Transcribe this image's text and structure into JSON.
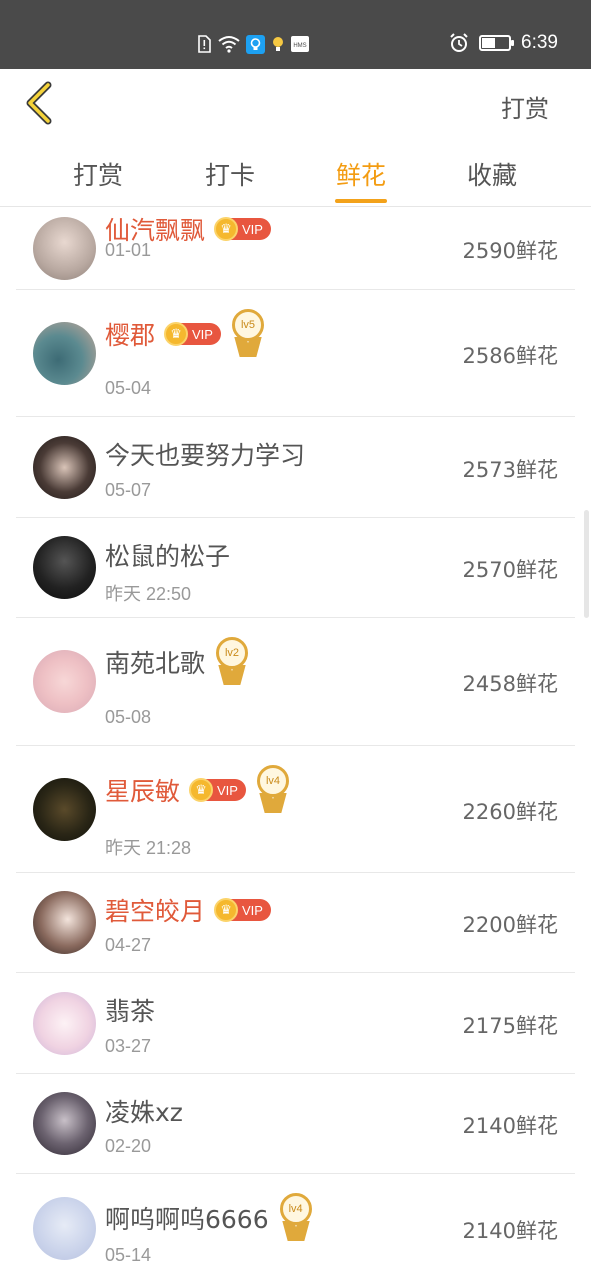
{
  "status_bar": {
    "time": "6:39",
    "icons": [
      "sim-alert-icon",
      "wifi-icon",
      "app-notification-icon",
      "bulb-icon",
      "hms-icon"
    ],
    "right_icons": [
      "alarm-icon",
      "battery-icon"
    ],
    "battery_level": 0.5
  },
  "header": {
    "back_icon": "chevron-left-icon",
    "action_label": "打赏"
  },
  "tabs": [
    {
      "label": "打赏",
      "active": false
    },
    {
      "label": "打卡",
      "active": false
    },
    {
      "label": "鲜花",
      "active": true
    },
    {
      "label": "收藏",
      "active": false
    }
  ],
  "colors": {
    "accent": "#f39c12",
    "vip_name": "#e05a3a",
    "status_bar": "#4a4a4a"
  },
  "list": [
    {
      "name": "仙汽飘飘",
      "vip": true,
      "vip_label": "VIP",
      "level": "",
      "date": "01-01",
      "amount": "2590鲜花"
    },
    {
      "name": "樱郡",
      "vip": true,
      "vip_label": "VIP",
      "level": "lv5",
      "date": "05-04",
      "amount": "2586鲜花"
    },
    {
      "name": "今天也要努力学习",
      "vip": false,
      "vip_label": "",
      "level": "",
      "date": "05-07",
      "amount": "2573鲜花"
    },
    {
      "name": "松鼠的松子",
      "vip": false,
      "vip_label": "",
      "level": "",
      "date": "昨天 22:50",
      "amount": "2570鲜花"
    },
    {
      "name": "南苑北歌",
      "vip": false,
      "vip_label": "",
      "level": "lv2",
      "date": "05-08",
      "amount": "2458鲜花"
    },
    {
      "name": "星辰敏",
      "vip": true,
      "vip_label": "VIP",
      "level": "lv4",
      "date": "昨天 21:28",
      "amount": "2260鲜花"
    },
    {
      "name": "碧空皎月",
      "vip": true,
      "vip_label": "VIP",
      "level": "",
      "date": "04-27",
      "amount": "2200鲜花"
    },
    {
      "name": "翡茶",
      "vip": false,
      "vip_label": "",
      "level": "",
      "date": "03-27",
      "amount": "2175鲜花"
    },
    {
      "name": "凌姝xz",
      "vip": false,
      "vip_label": "",
      "level": "",
      "date": "02-20",
      "amount": "2140鲜花"
    },
    {
      "name": "啊呜啊呜6666",
      "vip": false,
      "vip_label": "",
      "level": "lv4",
      "date": "05-14",
      "amount": "2140鲜花"
    }
  ]
}
